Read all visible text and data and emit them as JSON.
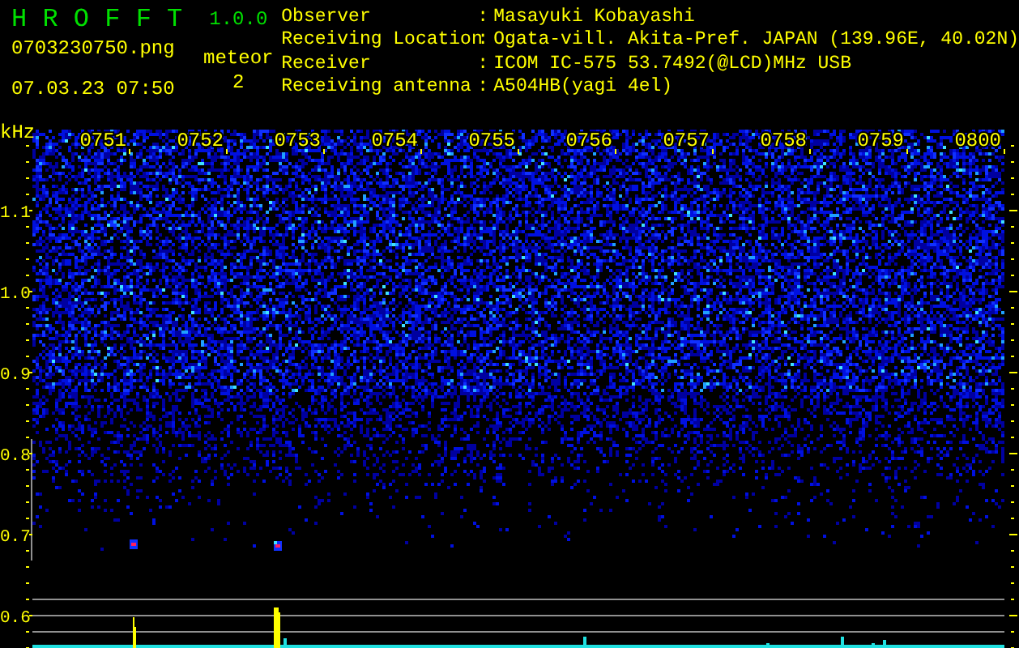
{
  "app": {
    "name": "H R O F F T",
    "version": "1.0.0"
  },
  "file": "0703230750.png",
  "datetime": "07.03.23 07:50",
  "meteor": {
    "label": "meteor",
    "count": "2"
  },
  "info": [
    {
      "label": "Observer",
      "colon": ":",
      "value": "Masayuki Kobayashi"
    },
    {
      "label": "Receiving Location",
      "colon": ":",
      "value": "Ogata-vill. Akita-Pref. JAPAN (139.96E, 40.02N)"
    },
    {
      "label": "Receiver",
      "colon": ":",
      "value": "ICOM IC-575 53.7492(@LCD)MHz USB"
    },
    {
      "label": "Receiving antenna",
      "colon": ":",
      "value": "A504HB(yagi 4el)"
    }
  ],
  "plot": {
    "unit": "kHz",
    "time_labels": [
      "0751",
      "0752",
      "0753",
      "0754",
      "0755",
      "0756",
      "0757",
      "0758",
      "0759",
      "0800"
    ],
    "freq_labels": [
      "1.1",
      "1.0",
      "0.9",
      "0.8",
      "0.7",
      "0.6"
    ]
  }
}
